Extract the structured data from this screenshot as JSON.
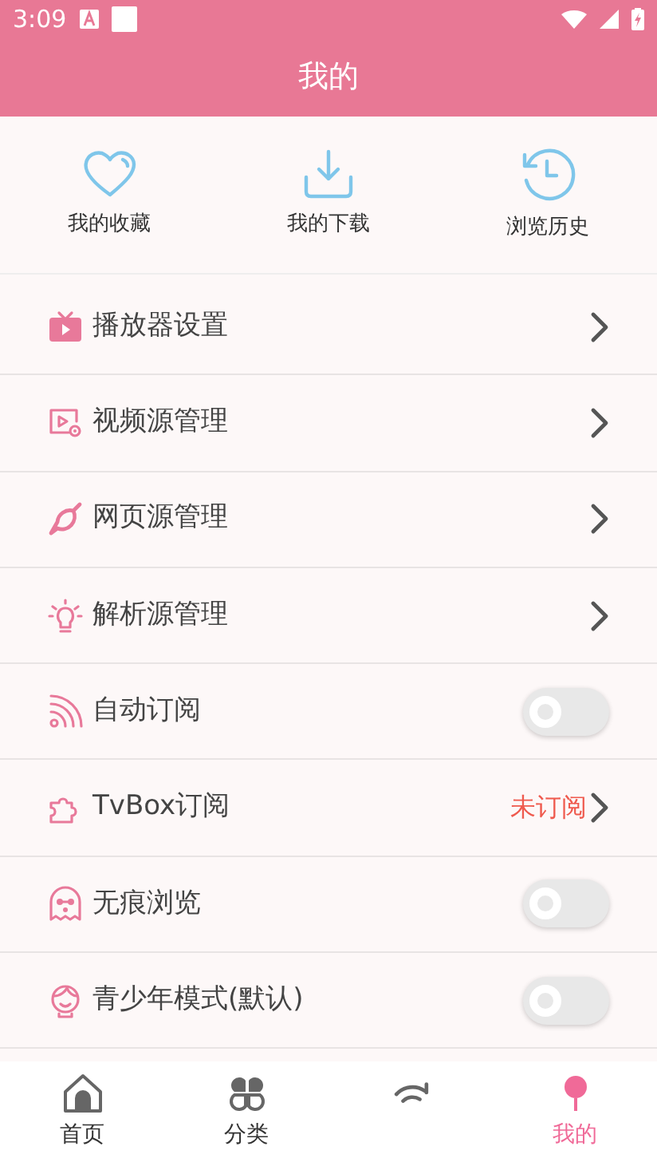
{
  "status_bar": {
    "time": "3:09"
  },
  "header": {
    "title": "我的"
  },
  "shortcuts": [
    {
      "label": "我的收藏"
    },
    {
      "label": "我的下载"
    },
    {
      "label": "浏览历史"
    }
  ],
  "settings": [
    {
      "kind": "link",
      "label": "播放器设置"
    },
    {
      "kind": "link",
      "label": "视频源管理"
    },
    {
      "kind": "link",
      "label": "网页源管理"
    },
    {
      "kind": "link",
      "label": "解析源管理"
    },
    {
      "kind": "switch",
      "label": "自动订阅",
      "on": false
    },
    {
      "kind": "link",
      "label": "TvBox订阅",
      "value": "未订阅"
    },
    {
      "kind": "switch",
      "label": "无痕浏览",
      "on": false
    },
    {
      "kind": "switch",
      "label": "青少年模式(默认)",
      "on": false
    }
  ],
  "bottom_nav": [
    {
      "label": "首页",
      "selected": false
    },
    {
      "label": "分类",
      "selected": false
    },
    {
      "selected": false
    },
    {
      "label": "我的",
      "selected": true
    }
  ]
}
